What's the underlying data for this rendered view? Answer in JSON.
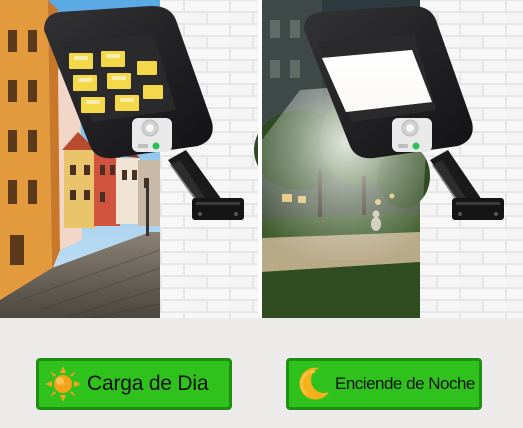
{
  "labels": {
    "day": {
      "text": "Carga de Dia",
      "icon": "sun-icon"
    },
    "night": {
      "text": "Enciende de Noche",
      "icon": "moon-icon"
    }
  },
  "colors": {
    "badge_green": "#2fc21d",
    "badge_border": "#1f8f12",
    "sun": "#f6a21a",
    "moon": "#f5b01c",
    "lamp_body": "#1c1c1e",
    "led_on": "#fff6d0"
  }
}
